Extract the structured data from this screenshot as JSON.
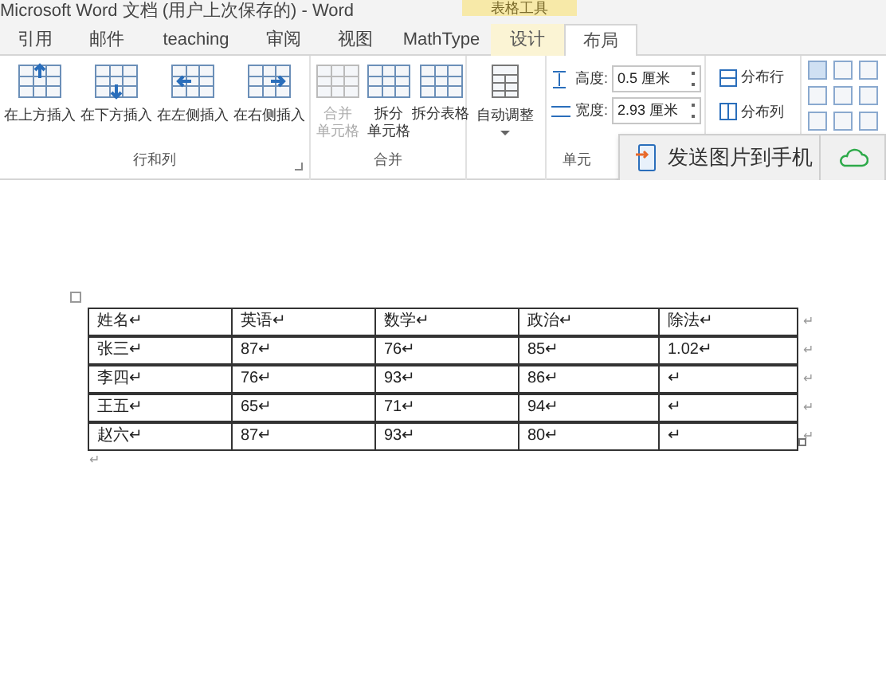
{
  "window": {
    "title": "Microsoft Word 文档 (用户上次保存的) - Word",
    "context_label": "表格工具"
  },
  "tabs": [
    {
      "label": "引用",
      "selected": false,
      "kind": "normal"
    },
    {
      "label": "邮件",
      "selected": false,
      "kind": "normal"
    },
    {
      "label": "teaching",
      "selected": false,
      "kind": "normal"
    },
    {
      "label": "审阅",
      "selected": false,
      "kind": "normal"
    },
    {
      "label": "视图",
      "selected": false,
      "kind": "normal"
    },
    {
      "label": "MathType",
      "selected": false,
      "kind": "normal"
    },
    {
      "label": "设计",
      "selected": false,
      "kind": "context"
    },
    {
      "label": "布局",
      "selected": true,
      "kind": "context"
    }
  ],
  "ribbon": {
    "rows_cols": {
      "buttons": [
        {
          "label": "在上方插入",
          "kind": "up"
        },
        {
          "label": "在下方插入",
          "kind": "down"
        },
        {
          "label": "在左侧插入",
          "kind": "left"
        },
        {
          "label": "在右侧插入",
          "kind": "right"
        }
      ],
      "group_label": "行和列"
    },
    "merge": {
      "buttons": [
        {
          "lines": [
            "合并",
            "单元格"
          ],
          "disabled": true
        },
        {
          "lines": [
            "拆分",
            "单元格"
          ],
          "disabled": false
        },
        {
          "lines": [
            "拆分表格"
          ],
          "disabled": false
        }
      ],
      "group_label": "合并"
    },
    "autofit": {
      "label": "自动调整"
    },
    "cell_size": {
      "fields": [
        {
          "label": "高度:",
          "value": "0.5 厘米"
        },
        {
          "label": "宽度:",
          "value": "2.93 厘米"
        }
      ],
      "group_label": "单元"
    },
    "distribute": [
      {
        "label": "分布行"
      },
      {
        "label": "分布列"
      }
    ]
  },
  "popup": {
    "label": "发送图片到手机"
  },
  "table": {
    "rows": [
      {
        "cells": [
          "姓名↵",
          "英语↵",
          "数学↵",
          "政治↵",
          "除法↵"
        ],
        "end_mark": "↵"
      },
      {
        "cells": [
          "张三↵",
          "87↵",
          "76↵",
          "85↵",
          "1.02↵"
        ],
        "end_mark": "↵"
      },
      {
        "cells": [
          "李四↵",
          "76↵",
          "93↵",
          "86↵",
          "↵"
        ],
        "end_mark": "↵"
      },
      {
        "cells": [
          "王五↵",
          "65↵",
          "71↵",
          "94↵",
          "↵"
        ],
        "end_mark": "↵"
      },
      {
        "cells": [
          "赵六↵",
          "87↵",
          "93↵",
          "80↵",
          "↵"
        ],
        "end_mark": "↵"
      }
    ]
  },
  "after_table_mark": "↵"
}
